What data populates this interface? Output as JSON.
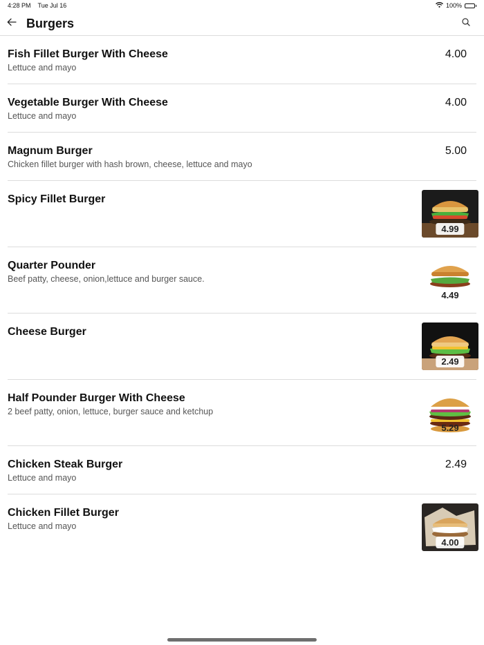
{
  "status_bar": {
    "time": "4:28 PM",
    "date": "Tue Jul 16",
    "battery": "100%"
  },
  "header": {
    "title": "Burgers"
  },
  "items": [
    {
      "name": "Fish Fillet Burger With Cheese",
      "description": "Lettuce and mayo",
      "price": "4.00",
      "image": null
    },
    {
      "name": "Vegetable Burger With Cheese",
      "description": "Lettuce and mayo",
      "price": "4.00",
      "image": null
    },
    {
      "name": "Magnum Burger",
      "description": "Chicken fillet burger with hash brown, cheese, lettuce and mayo",
      "price": "5.00",
      "image": null
    },
    {
      "name": "Spicy Fillet Burger",
      "description": "",
      "price": "4.99",
      "image": "burger-photo-dark"
    },
    {
      "name": "Quarter Pounder",
      "description": "Beef patty, cheese, onion,lettuce and burger sauce.",
      "price": "4.49",
      "image": "burger-photo-light"
    },
    {
      "name": "Cheese Burger",
      "description": "",
      "price": "2.49",
      "image": "burger-photo-dark"
    },
    {
      "name": "Half Pounder Burger With Cheese",
      "description": "2 beef patty, onion, lettuce, burger sauce and ketchup",
      "price": "5.29",
      "image": "burger-photo-light"
    },
    {
      "name": "Chicken Steak Burger",
      "description": "Lettuce and mayo",
      "price": "2.49",
      "image": null
    },
    {
      "name": "Chicken Fillet Burger",
      "description": "Lettuce and mayo",
      "price": "4.00",
      "image": "burger-photo-dark"
    }
  ]
}
